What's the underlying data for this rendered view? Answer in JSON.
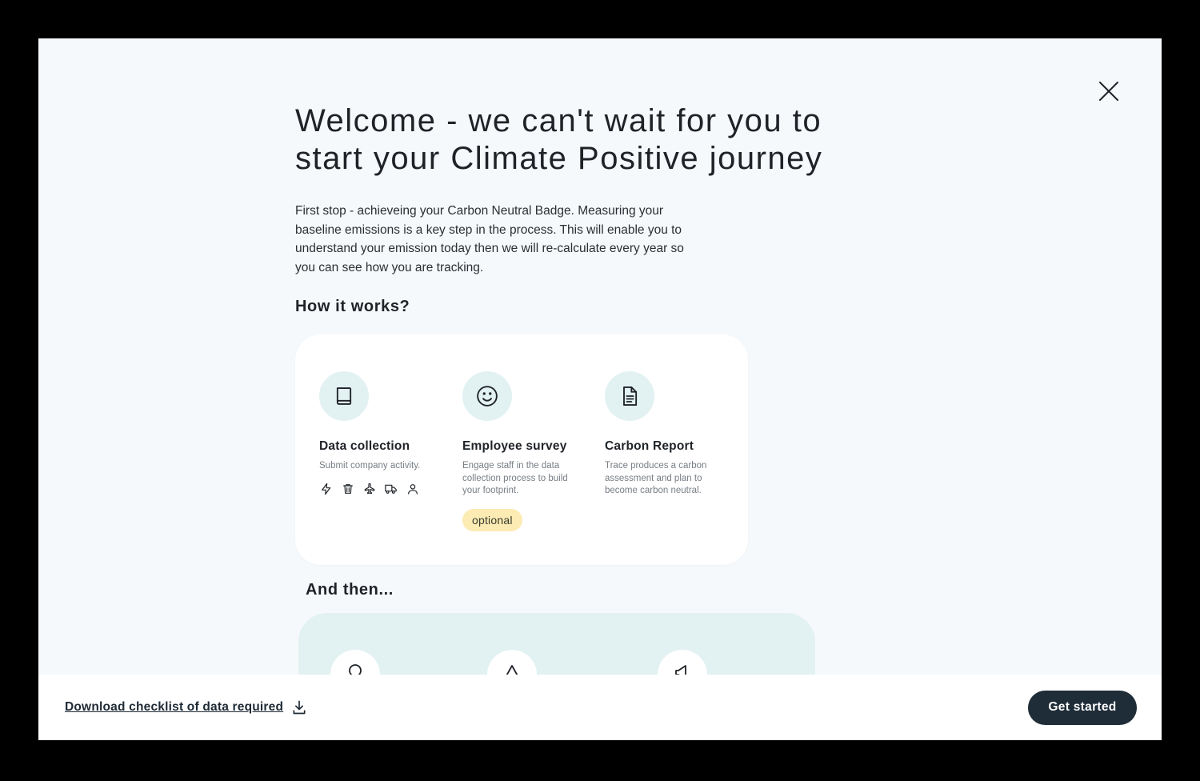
{
  "modal": {
    "title": "Welcome - we can't wait for you to start your Climate Positive journey",
    "intro": "First stop - achieveing your Carbon Neutral Badge. Measuring your baseline emissions is a key step in the process. This will enable you to understand your emission today then we will re-calculate every year so you can see how you are tracking.",
    "how_title": "How it works?",
    "steps": [
      {
        "icon": "book-icon",
        "title": "Data collection",
        "description": "Submit company activity."
      },
      {
        "icon": "smile-icon",
        "title": "Employee survey",
        "description": "Engage staff in the data collection process to build your footprint.",
        "badge": "optional"
      },
      {
        "icon": "document-icon",
        "title": "Carbon Report",
        "description": "Trace produces a carbon assessment and plan to become carbon neutral."
      }
    ],
    "activity_icons": [
      "lightning-icon",
      "trash-icon",
      "plane-icon",
      "truck-icon",
      "person-icon"
    ],
    "then_title": "And then...",
    "then_icons": [
      "pin-icon",
      "mountain-icon",
      "megaphone-icon"
    ]
  },
  "footer": {
    "download_label": "Download checklist of data required",
    "primary_label": "Get started"
  },
  "colors": {
    "accent_light": "#e2f1f2",
    "badge_bg": "#fcebb2",
    "button_bg": "#1f2d39",
    "modal_bg": "#f6f9fb"
  }
}
